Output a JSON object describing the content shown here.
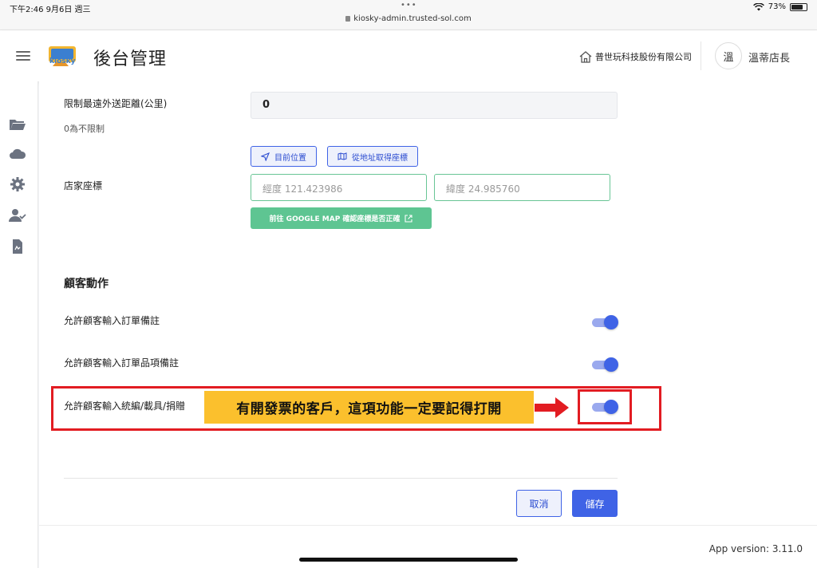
{
  "status_bar": {
    "time": "下午2:46  9月6日 週三",
    "url": "kiosky-admin.trusted-sol.com",
    "battery": "73%"
  },
  "header": {
    "title": "後台管理",
    "logo_text": "kiosky",
    "company": "普世玩科技股份有限公司",
    "avatar_char": "溫",
    "user_name": "溫蒂店長"
  },
  "sidebar": {
    "icons": [
      "folder-icon",
      "cloud-icon",
      "gear-icon",
      "user-check-icon",
      "document-icon"
    ]
  },
  "form": {
    "max_distance_label": "限制最遠外送距離(公里)",
    "max_distance_hint": "0為不限制",
    "max_distance_value": "0",
    "location_button": "目前位置",
    "address_button": "從地址取得座標",
    "coords_label": "店家座標",
    "longitude": "經度 121.423986",
    "latitude": "緯度 24.985760",
    "google_map_button": "前往 GOOGLE MAP 確認座標是否正確"
  },
  "customer_actions": {
    "title": "顧客動作",
    "items": [
      {
        "label": "允許顧客輸入訂單備註",
        "enabled": true
      },
      {
        "label": "允許顧客輸入訂單品項備註",
        "enabled": true
      },
      {
        "label": "允許顧客輸入統編/載具/捐贈",
        "enabled": true
      }
    ]
  },
  "annotation": {
    "text": "有開發票的客戶，這項功能一定要記得打開",
    "box_color": "#e21c22",
    "callout_color": "#fbc02d"
  },
  "actions": {
    "cancel": "取消",
    "save": "儲存"
  },
  "footer": {
    "version": "App version: 3.11.0"
  },
  "colors": {
    "accent": "#3f63e6",
    "green": "#5ec592"
  }
}
